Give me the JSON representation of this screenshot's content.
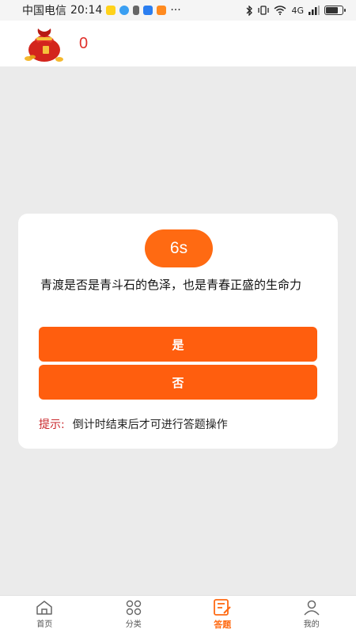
{
  "status_bar": {
    "carrier": "中国电信",
    "time": "20:14",
    "network": "4G",
    "battery_level": 0.7,
    "dots": "···"
  },
  "header": {
    "coin_count": "0",
    "icon": "money-bag-icon"
  },
  "quiz": {
    "timer": "6s",
    "question": "青渡是否是青斗石的色泽，也是青春正盛的生命力",
    "options": [
      "是",
      "否"
    ],
    "hint_label": "提示:",
    "hint_text": "倒计时结束后才可进行答题操作"
  },
  "nav": {
    "items": [
      {
        "label": "首页",
        "icon": "home-icon"
      },
      {
        "label": "分类",
        "icon": "category-icon"
      },
      {
        "label": "答题",
        "icon": "answer-icon"
      },
      {
        "label": "我的",
        "icon": "profile-icon"
      }
    ],
    "active": "答题"
  },
  "colors": {
    "accent": "#ff5e0e",
    "timer_bg": "#ff6a12",
    "hint_label": "#c9262a",
    "coin": "#e0312b"
  }
}
